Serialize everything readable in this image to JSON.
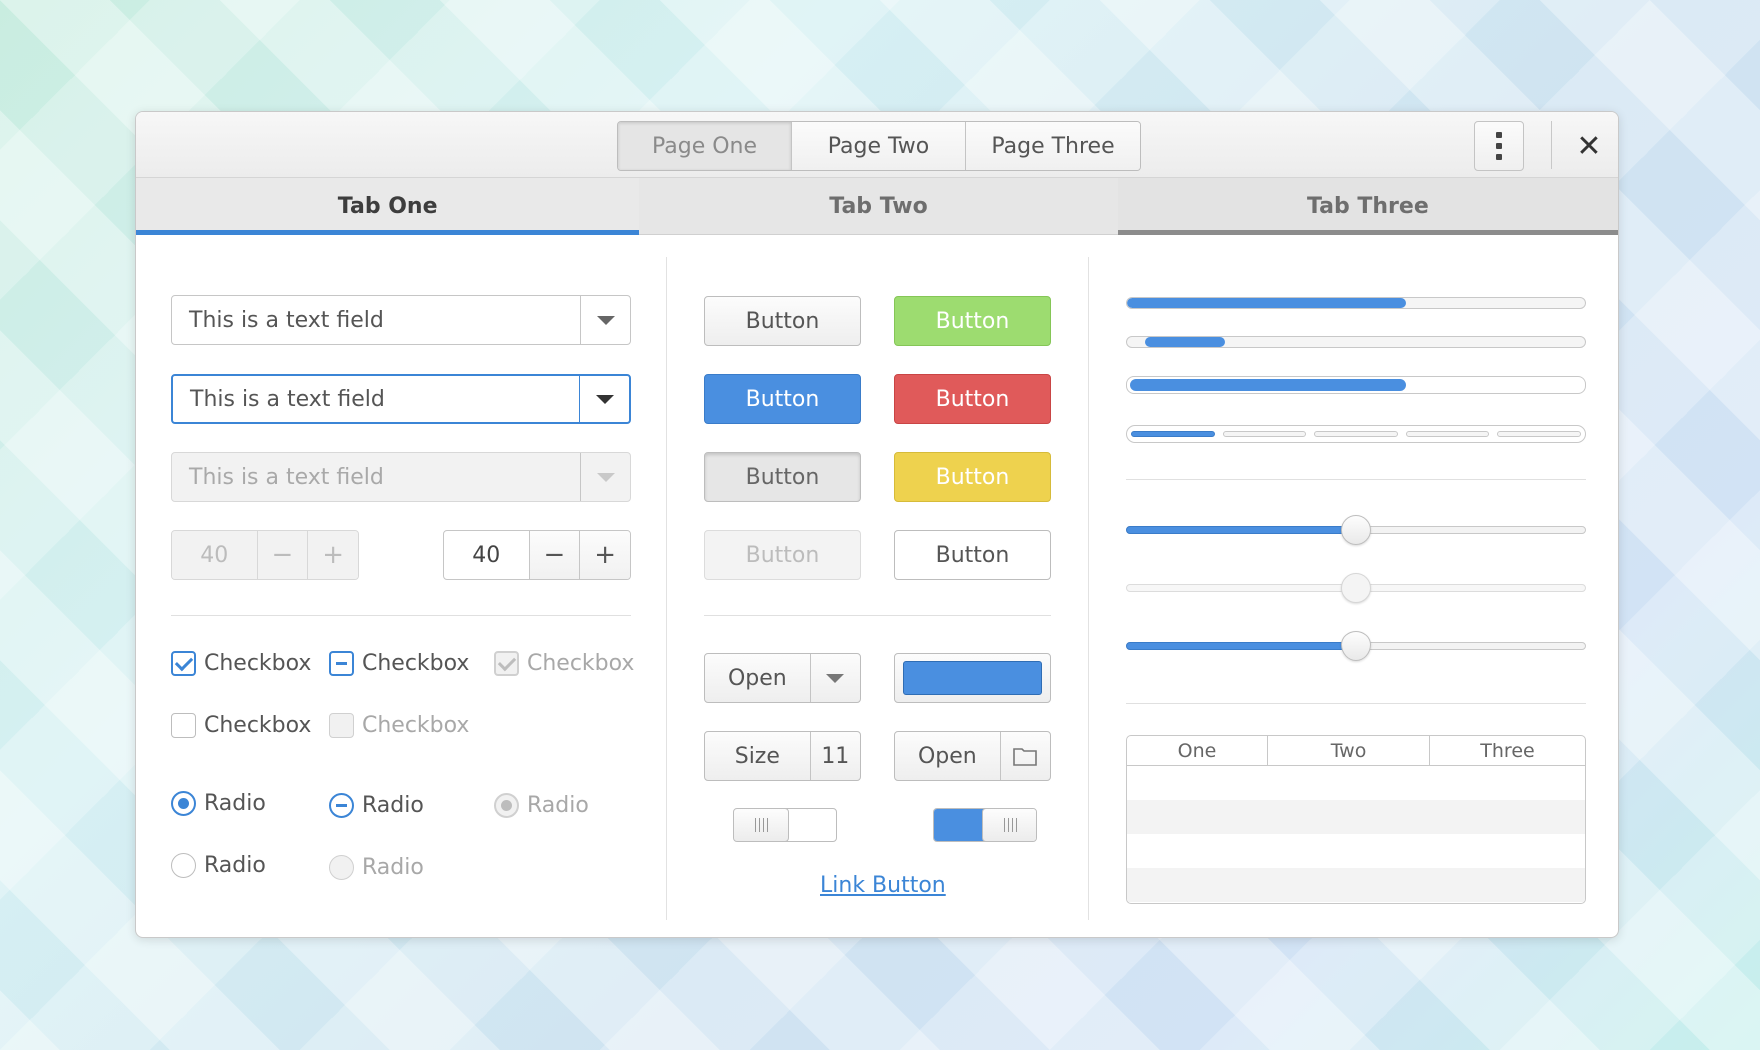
{
  "header": {
    "stack_pages": [
      "Page One",
      "Page Two",
      "Page Three"
    ],
    "active_page": "Page One",
    "menu_icon": "kebab-menu-icon",
    "close_label": "✕"
  },
  "tabs": [
    {
      "label": "Tab One"
    },
    {
      "label": "Tab Two"
    },
    {
      "label": "Tab Three"
    }
  ],
  "left": {
    "combo1": "This is a text field",
    "combo2": "This is a text field",
    "combo3": "This is a text field",
    "spin_disabled": {
      "value": "40",
      "minus": "−",
      "plus": "+"
    },
    "spin": {
      "value": "40",
      "minus": "−",
      "plus": "+"
    },
    "checkboxes": [
      {
        "label": "Checkbox",
        "state": "checked"
      },
      {
        "label": "Checkbox",
        "state": "mixed"
      },
      {
        "label": "Checkbox",
        "state": "checked-disabled"
      },
      {
        "label": "Checkbox",
        "state": "unchecked"
      },
      {
        "label": "Checkbox",
        "state": "unchecked-disabled"
      }
    ],
    "radios": [
      {
        "label": "Radio",
        "state": "selected"
      },
      {
        "label": "Radio",
        "state": "mixed"
      },
      {
        "label": "Radio",
        "state": "selected-disabled"
      },
      {
        "label": "Radio",
        "state": "unselected"
      },
      {
        "label": "Radio",
        "state": "unselected-disabled"
      }
    ]
  },
  "middle": {
    "buttons": [
      "Button",
      "Button",
      "Button",
      "Button",
      "Button",
      "Button",
      "Button",
      "Button"
    ],
    "open_combo": "Open",
    "color": "#4a8fe0",
    "size_label": "Size",
    "size_value": "11",
    "file_open": "Open",
    "folder_icon": "folder-icon",
    "switch_off": false,
    "switch_on": true,
    "link": "Link Button"
  },
  "right": {
    "progress": [
      0.61,
      0.17,
      0.61
    ],
    "level_segments": 5,
    "level_filled": 1,
    "scales": [
      0.5,
      0.5,
      0.5
    ],
    "tree_columns": [
      "One",
      "Two",
      "Three"
    ]
  },
  "colors": {
    "accent": "#3b85d6",
    "green": "#9ddc70",
    "red": "#e05a5a",
    "yellow": "#eed24e"
  }
}
